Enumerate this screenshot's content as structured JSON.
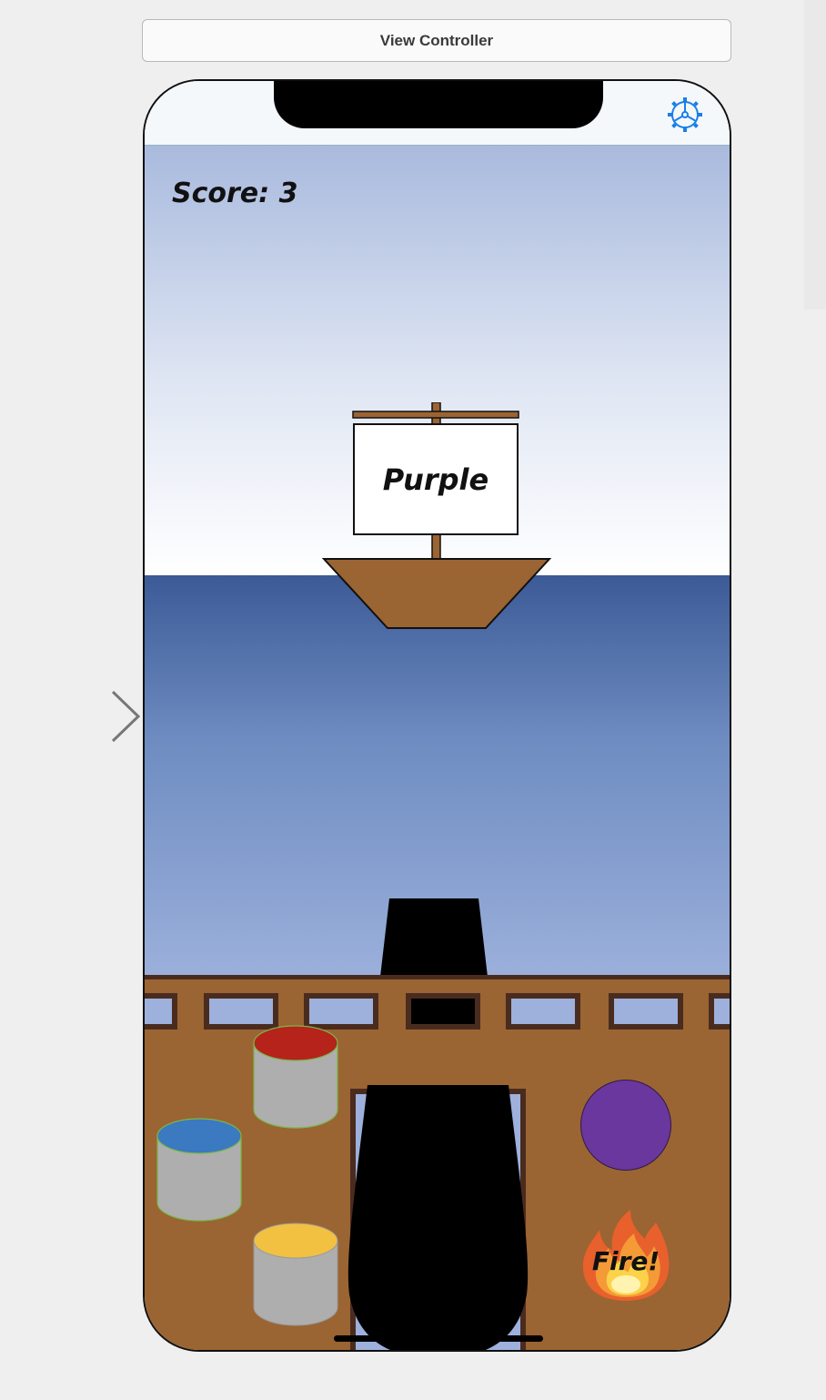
{
  "storyboard": {
    "scene_title": "View Controller"
  },
  "game": {
    "score_label": "Score: 3",
    "target_color_word": "Purple",
    "fire_button_label": "Fire!",
    "selected_ball_color": "#6a379e"
  },
  "buckets": [
    {
      "name": "red-paint-bucket",
      "color": "#b5231b"
    },
    {
      "name": "blue-paint-bucket",
      "color": "#3b79c0"
    },
    {
      "name": "yellow-paint-bucket",
      "color": "#f2c141"
    }
  ],
  "icons": {
    "settings": "gear-icon",
    "entry_point": "arrow-right-icon",
    "fire": "flame-icon"
  },
  "colors": {
    "deck": "#9b6433",
    "deck_dark": "#4a2c1f",
    "accent_blue": "#1a7fe8"
  }
}
